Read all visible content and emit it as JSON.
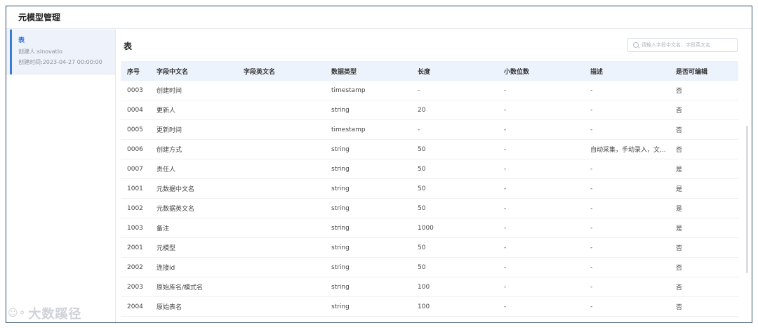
{
  "header": {
    "title": "元模型管理"
  },
  "sidebar": {
    "items": [
      {
        "title": "表",
        "creator": "创建人:sinovatio",
        "created_at": "创建时间:2023-04-27 00:00:00"
      }
    ]
  },
  "main": {
    "title": "表",
    "search": {
      "placeholder": "请输入字段中文名、字段英文名"
    },
    "table": {
      "columns": [
        "序号",
        "字段中文名",
        "字段英文名",
        "数据类型",
        "长度",
        "小数位数",
        "描述",
        "是否可编辑"
      ],
      "rows": [
        [
          "0003",
          "创建时间",
          "",
          "timestamp",
          "-",
          "-",
          "-",
          "否"
        ],
        [
          "0004",
          "更新人",
          "",
          "string",
          "20",
          "-",
          "-",
          "否"
        ],
        [
          "0005",
          "更新时间",
          "",
          "timestamp",
          "-",
          "-",
          "-",
          "否"
        ],
        [
          "0006",
          "创建方式",
          "",
          "string",
          "50",
          "-",
          "自动采集，手动录入，文...",
          "否"
        ],
        [
          "0007",
          "责任人",
          "",
          "string",
          "50",
          "-",
          "-",
          "是"
        ],
        [
          "1001",
          "元数据中文名",
          "",
          "string",
          "50",
          "-",
          "-",
          "是"
        ],
        [
          "1002",
          "元数据英文名",
          "",
          "string",
          "50",
          "-",
          "-",
          "是"
        ],
        [
          "1003",
          "备注",
          "",
          "string",
          "1000",
          "-",
          "-",
          "是"
        ],
        [
          "2001",
          "元模型",
          "",
          "string",
          "50",
          "-",
          "-",
          "否"
        ],
        [
          "2002",
          "连接id",
          "",
          "string",
          "50",
          "-",
          "-",
          "否"
        ],
        [
          "2003",
          "原始库名/模式名",
          "",
          "string",
          "100",
          "-",
          "-",
          "否"
        ],
        [
          "2004",
          "原始表名",
          "",
          "string",
          "100",
          "-",
          "-",
          "否"
        ]
      ]
    }
  },
  "watermark": {
    "icon": "wechat-icon",
    "text": "大数蹊径"
  }
}
